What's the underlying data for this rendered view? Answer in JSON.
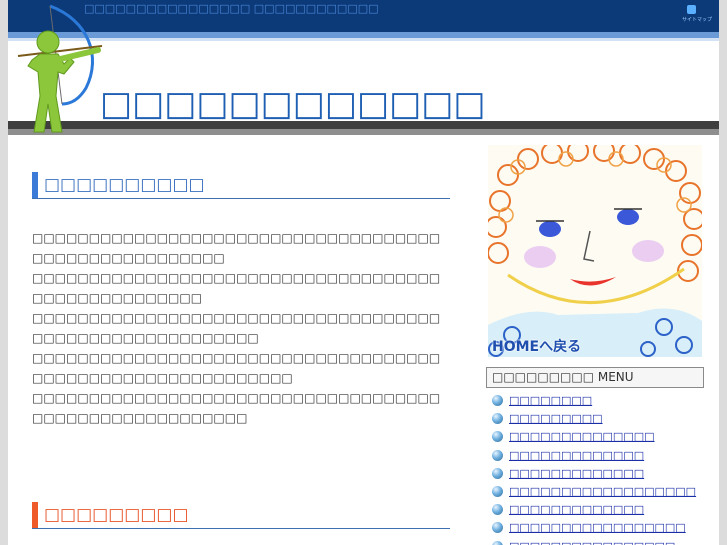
{
  "header": {
    "tagline": "□□□□□□□□□□□□□□□□ □□□□□□□□□□□□",
    "title": "□□□□□□□□□□□□",
    "sitemap_label": "サイトマップ"
  },
  "main": {
    "section1_title": "□□□□□□□□□□",
    "paragraphs": [
      "□□□□□□□□□□□□□□□□□□□□□□□□□□□□□□□□□□□□□□□□□□□□□□□□□□□□□",
      "□□□□□□□□□□□□□□□□□□□□□□□□□□□□□□□□□□□□□□□□□□□□□□□□□□□",
      "□□□□□□□□□□□□□□□□□□□□□□□□□□□□□□□□□□□□□□□□□□□□□□□□□□□□□□□□",
      "□□□□□□□□□□□□□□□□□□□□□□□□□□□□□□□□□□□□□□□□□□□□□□□□□□□□□□□□□□□",
      "□□□□□□□□□□□□□□□□□□□□□□□□□□□□□□□□□□□□□□□□□□□□□□□□□□□□□□□"
    ],
    "section2_title": "□□□□□□□□□"
  },
  "sidebar": {
    "home_link": "HOMEへ戻る",
    "menu_title": "□□□□□□□□□ MENU",
    "menu_items": [
      "□□□□□□□□",
      "□□□□□□□□□",
      "□□□□□□□□□□□□□□",
      "□□□□□□□□□□□□□",
      "□□□□□□□□□□□□□",
      "□□□□□□□□□□□□□□□□□□",
      "□□□□□□□□□□□□□",
      "□□□□□□□□□□□□□□□□□",
      "□□□□□□□□□□□□□□□□"
    ]
  },
  "colors": {
    "header_bar": "#0c3a78",
    "title": "#1f5fb3",
    "section1_accent": "#3b7ad6",
    "section2_accent": "#ee5a2a",
    "link": "#1a2ea8"
  },
  "icons": {
    "logo": "archer-logo-icon",
    "sitemap": "sitemap-icon",
    "bullet": "globe-bullet-icon"
  }
}
